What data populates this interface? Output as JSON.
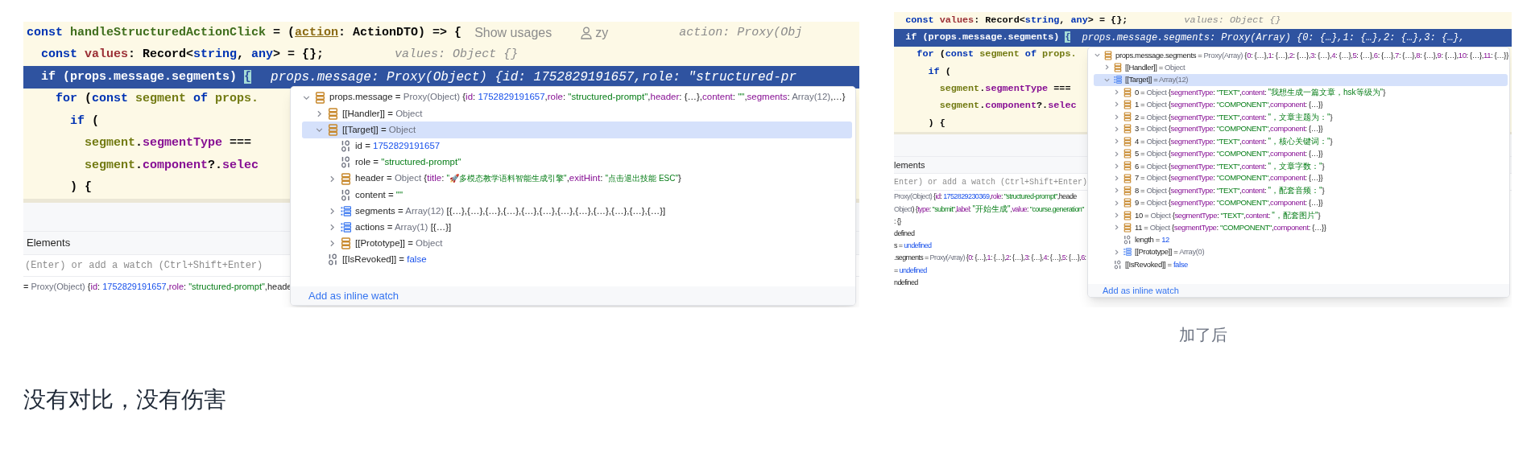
{
  "screenshots": [
    {
      "editor": {
        "lines": [
          {
            "highlighted": false,
            "tokens": [
              {
                "text": "const",
                "kind": "kw"
              },
              {
                "text": " handleStructuredActionClick",
                "kind": "fn"
              },
              {
                "text": " = (",
                "kind": "plain"
              },
              {
                "text": "action",
                "kind": "param"
              },
              {
                "text": ": ActionDTO) => {",
                "kind": "plain"
              }
            ],
            "annotations": [
              {
                "kind": "usages",
                "text": "Show usages"
              },
              {
                "kind": "author",
                "text": "zy"
              },
              {
                "kind": "hint",
                "text": "action: Proxy(Obj"
              }
            ]
          },
          {
            "highlighted": false,
            "tokens": [
              {
                "text": "  const",
                "kind": "kw"
              },
              {
                "text": " values",
                "kind": "local"
              },
              {
                "text": ": Record<",
                "kind": "plain"
              },
              {
                "text": "string",
                "kind": "kw"
              },
              {
                "text": ", ",
                "kind": "plain"
              },
              {
                "text": "any",
                "kind": "kw"
              },
              {
                "text": "> = {};",
                "kind": "plain"
              }
            ],
            "annotations": [
              {
                "kind": "hint",
                "text": "values: Object {}"
              }
            ]
          },
          {
            "highlighted": true,
            "tokens": [
              {
                "text": "  if",
                "kind": "kw"
              },
              {
                "text": " (props.message.segments) ",
                "kind": "plain"
              },
              {
                "text": "{",
                "kind": "brace"
              }
            ],
            "annotations": [
              {
                "kind": "hint",
                "text": "props.message: Proxy(Object) {id: 1752829191657,role: \"structured-pr"
              }
            ]
          },
          {
            "highlighted": false,
            "tokens": [
              {
                "text": "    for",
                "kind": "kw"
              },
              {
                "text": " (",
                "kind": "plain"
              },
              {
                "text": "const",
                "kind": "kw"
              },
              {
                "text": " segment",
                "kind": "olive"
              },
              {
                "text": " of",
                "kind": "kw"
              },
              {
                "text": " props.",
                "kind": "olive"
              }
            ]
          },
          {
            "highlighted": false,
            "tokens": [
              {
                "text": "      if",
                "kind": "kw"
              },
              {
                "text": " (",
                "kind": "plain"
              }
            ]
          },
          {
            "highlighted": false,
            "tokens": [
              {
                "text": "        segment",
                "kind": "olive"
              },
              {
                "text": ".",
                "kind": "plain"
              },
              {
                "text": "segmentType",
                "kind": "prop"
              },
              {
                "text": " ===",
                "kind": "plain"
              }
            ]
          },
          {
            "highlighted": false,
            "tokens": [
              {
                "text": "        segment",
                "kind": "olive"
              },
              {
                "text": ".",
                "kind": "plain"
              },
              {
                "text": "component",
                "kind": "prop"
              },
              {
                "text": "?.",
                "kind": "plain"
              },
              {
                "text": "selec",
                "kind": "prop"
              }
            ]
          },
          {
            "highlighted": false,
            "tokens": [
              {
                "text": "      ) {",
                "kind": "plain"
              }
            ]
          }
        ]
      },
      "popup": {
        "tree": [
          {
            "label": "props.message = Proxy(Object) {id: 1752829191657,role: \"structured-prompt\",header: {…},content: \"\",segments: Array(12),…}",
            "kind": "object",
            "expanded": true,
            "selected": false,
            "children": [
              {
                "label": "[[Handler]] = Object",
                "kind": "object",
                "expanded": false,
                "selected": false
              },
              {
                "label": "[[Target]] = Object",
                "kind": "object",
                "expanded": true,
                "selected": true,
                "children": [
                  {
                    "label": "id = 1752829191657",
                    "kind": "primitive",
                    "selected": false
                  },
                  {
                    "label": "role = \"structured-prompt\"",
                    "kind": "primitive",
                    "selected": false
                  },
                  {
                    "label": "header = Object {title: \"🚀多模态教学语料智能生成引擎\",exitHint: \"点击退出技能 ESC\"}",
                    "kind": "object",
                    "expanded": false,
                    "selected": false
                  },
                  {
                    "label": "content = \"\"",
                    "kind": "primitive",
                    "selected": false
                  },
                  {
                    "label": "segments = Array(12) [{…},{…},{…},{…},{…},{…},{…},{…},{…},{…},{…},{…}]",
                    "kind": "array",
                    "expanded": false,
                    "selected": false
                  },
                  {
                    "label": "actions = Array(1) [{…}]",
                    "kind": "array",
                    "expanded": false,
                    "selected": false
                  },
                  {
                    "label": "[[Prototype]] = Object",
                    "kind": "object",
                    "expanded": false,
                    "selected": false
                  }
                ]
              },
              {
                "label": "[[IsRevoked]] = false",
                "kind": "primitive",
                "selected": false
              }
            ]
          }
        ],
        "footer_link": "Add as inline watch"
      },
      "debug_panel": {
        "tab": "Elements",
        "watch_field": {
          "placeholder": "(Enter) or add a watch (Ctrl+Shift+Enter)"
        },
        "variables": [
          "= Proxy(Object) {id: 1752829191657,role: \"structured-prompt\",heade"
        ]
      }
    },
    {
      "editor": {
        "lines": [
          {
            "highlighted": false,
            "tokens": [
              {
                "text": "  const",
                "kind": "kw"
              },
              {
                "text": " values",
                "kind": "local"
              },
              {
                "text": ": Record<",
                "kind": "plain"
              },
              {
                "text": "string",
                "kind": "kw"
              },
              {
                "text": ", ",
                "kind": "plain"
              },
              {
                "text": "any",
                "kind": "kw"
              },
              {
                "text": "> = {};",
                "kind": "plain"
              }
            ],
            "annotations": [
              {
                "kind": "hint",
                "text": "values: Object {}"
              }
            ]
          },
          {
            "highlighted": true,
            "tokens": [
              {
                "text": "  if",
                "kind": "kw"
              },
              {
                "text": " (props.message.segments) ",
                "kind": "plain"
              },
              {
                "text": "{",
                "kind": "brace"
              }
            ],
            "annotations": [
              {
                "kind": "hint",
                "text": "props.message.segments: Proxy(Array) {0: {…},1: {…},2: {…},3: {…},"
              }
            ]
          },
          {
            "highlighted": false,
            "tokens": [
              {
                "text": "    for",
                "kind": "kw"
              },
              {
                "text": " (",
                "kind": "plain"
              },
              {
                "text": "const",
                "kind": "kw"
              },
              {
                "text": " segment",
                "kind": "olive"
              },
              {
                "text": " of",
                "kind": "kw"
              },
              {
                "text": " props.",
                "kind": "olive"
              }
            ]
          },
          {
            "highlighted": false,
            "tokens": [
              {
                "text": "      if",
                "kind": "kw"
              },
              {
                "text": " (",
                "kind": "plain"
              }
            ]
          },
          {
            "highlighted": false,
            "tokens": [
              {
                "text": "        segment",
                "kind": "olive"
              },
              {
                "text": ".",
                "kind": "plain"
              },
              {
                "text": "segmentType",
                "kind": "prop"
              },
              {
                "text": " ===",
                "kind": "plain"
              }
            ]
          },
          {
            "highlighted": false,
            "tokens": [
              {
                "text": "        segment",
                "kind": "olive"
              },
              {
                "text": ".",
                "kind": "plain"
              },
              {
                "text": "component",
                "kind": "prop"
              },
              {
                "text": "?.",
                "kind": "plain"
              },
              {
                "text": "selec",
                "kind": "prop"
              }
            ]
          },
          {
            "highlighted": false,
            "tokens": [
              {
                "text": "      ) {",
                "kind": "plain"
              }
            ]
          }
        ]
      },
      "popup": {
        "tree": [
          {
            "label": "props.message.segments = Proxy(Array) {0: {…},1: {…},2: {…},3: {…},4: {…},5: {…},6: {…},7: {…},8: {…},9: {…},10: {…},11: {…}}",
            "kind": "object",
            "expanded": true,
            "selected": false,
            "children": [
              {
                "label": "[[Handler]] = Object",
                "kind": "object",
                "expanded": false,
                "selected": false
              },
              {
                "label": "[[Target]] = Array(12)",
                "kind": "array",
                "expanded": true,
                "selected": true,
                "children": [
                  {
                    "label": "0 = Object {segmentType: \"TEXT\",content: \"我想生成一篇文章，hsk等级为\"}",
                    "kind": "object",
                    "expanded": false,
                    "selected": false
                  },
                  {
                    "label": "1 = Object {segmentType: \"COMPONENT\",component: {…}}",
                    "kind": "object",
                    "expanded": false,
                    "selected": false
                  },
                  {
                    "label": "2 = Object {segmentType: \"TEXT\",content: \"，文章主题为：\"}",
                    "kind": "object",
                    "expanded": false,
                    "selected": false
                  },
                  {
                    "label": "3 = Object {segmentType: \"COMPONENT\",component: {…}}",
                    "kind": "object",
                    "expanded": false,
                    "selected": false
                  },
                  {
                    "label": "4 = Object {segmentType: \"TEXT\",content: \"，核心关键词：\"}",
                    "kind": "object",
                    "expanded": false,
                    "selected": false
                  },
                  {
                    "label": "5 = Object {segmentType: \"COMPONENT\",component: {…}}",
                    "kind": "object",
                    "expanded": false,
                    "selected": false
                  },
                  {
                    "label": "6 = Object {segmentType: \"TEXT\",content: \"，文章字数：\"}",
                    "kind": "object",
                    "expanded": false,
                    "selected": false
                  },
                  {
                    "label": "7 = Object {segmentType: \"COMPONENT\",component: {…}}",
                    "kind": "object",
                    "expanded": false,
                    "selected": false
                  },
                  {
                    "label": "8 = Object {segmentType: \"TEXT\",content: \"，配套音频：\"}",
                    "kind": "object",
                    "expanded": false,
                    "selected": false
                  },
                  {
                    "label": "9 = Object {segmentType: \"COMPONENT\",component: {…}}",
                    "kind": "object",
                    "expanded": false,
                    "selected": false
                  },
                  {
                    "label": "10 = Object {segmentType: \"TEXT\",content: \"，配套图片\"}",
                    "kind": "object",
                    "expanded": false,
                    "selected": false
                  },
                  {
                    "label": "11 = Object {segmentType: \"COMPONENT\",component: {…}}",
                    "kind": "object",
                    "expanded": false,
                    "selected": false
                  },
                  {
                    "label": "length = 12",
                    "kind": "primitive",
                    "selected": false
                  },
                  {
                    "label": "[[Prototype]] = Array(0)",
                    "kind": "array",
                    "expanded": false,
                    "selected": false
                  }
                ]
              },
              {
                "label": "[[IsRevoked]] = false",
                "kind": "primitive",
                "selected": false
              }
            ]
          }
        ],
        "footer_link": "Add as inline watch"
      },
      "debug_panel": {
        "tab": "lements",
        "watch_field": {
          "placeholder": "Enter) or add a watch (Ctrl+Shift+Enter)"
        },
        "variables": [
          "Proxy(Object) {id: 1752829230369,role: \"structured-prompt\",heade",
          "Object) {type: \"submit\",label: \"开始生成\",value: \"course.generation\"",
          ": {}",
          "defined",
          "s = undefined",
          ".segments = Proxy(Array) {0: {…},1: {…},2: {…},3: {…},4: {…},5: {…},6:",
          "= undefined",
          "ndefined"
        ]
      },
      "caption": "加了后"
    }
  ],
  "paragraph": "没有对比，没有伤害"
}
